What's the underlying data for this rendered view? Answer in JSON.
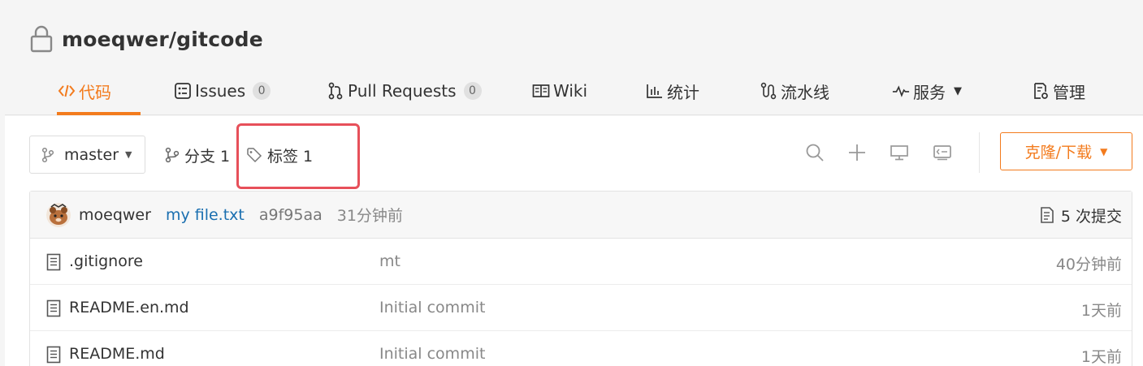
{
  "repo": {
    "title": "moeqwer/gitcode",
    "lock_icon": "lock-icon"
  },
  "tabs": [
    {
      "label": "代码",
      "icon": "code-icon",
      "active": true
    },
    {
      "label": "Issues",
      "icon": "issues-icon",
      "count": "0"
    },
    {
      "label": "Pull Requests",
      "icon": "pull-request-icon",
      "count": "0"
    },
    {
      "label": "Wiki",
      "icon": "book-icon"
    },
    {
      "label": "统计",
      "icon": "bar-chart-icon"
    },
    {
      "label": "流水线",
      "icon": "pipeline-icon"
    },
    {
      "label": "服务",
      "icon": "pulse-icon"
    },
    {
      "label": "管理",
      "icon": "settings-doc-icon"
    }
  ],
  "toolbar": {
    "branch": "master",
    "branches_label": "分支 1",
    "tags_label": "标签 1",
    "clone_label": "克隆/下载",
    "icons": [
      "search-icon",
      "plus-icon",
      "monitor-icon",
      "web-ide-icon"
    ]
  },
  "commit": {
    "author": "moeqwer",
    "message": "my file.txt",
    "sha": "a9f95aa",
    "time": "31分钟前",
    "count_label": "5 次提交"
  },
  "files": [
    {
      "name": ".gitignore",
      "message": "mt",
      "time": "40分钟前"
    },
    {
      "name": "README.en.md",
      "message": "Initial commit",
      "time": "1天前"
    },
    {
      "name": "README.md",
      "message": "Initial commit",
      "time": "1天前"
    }
  ],
  "colors": {
    "accent": "#f37b1d",
    "link": "#1a6fb0",
    "highlight": "#e7505a"
  }
}
